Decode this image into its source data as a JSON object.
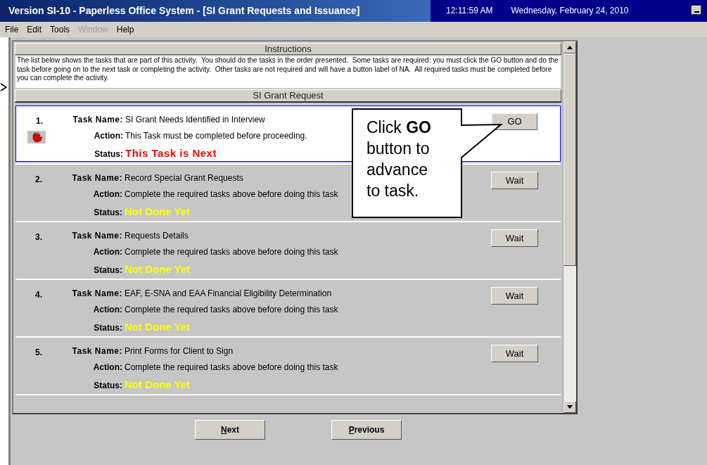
{
  "window": {
    "title": "Version SI-10 - Paperless Office System - [SI Grant Requests and Issuance]",
    "time": "12:11:59 AM",
    "date": "Wednesday, February 24, 2010"
  },
  "menu": [
    {
      "label": "File",
      "disabled": false
    },
    {
      "label": "Edit",
      "disabled": false
    },
    {
      "label": "Tools",
      "disabled": false
    },
    {
      "label": "Window",
      "disabled": true
    },
    {
      "label": "Help",
      "disabled": false
    }
  ],
  "instructions": {
    "heading": "Instructions",
    "text": "The list below shows the tasks that are part of this activity.  You should do the tasks in the order presented.  Some tasks are required: you must click the GO button and do the task before going on to the next task or completing the activity.  Other tasks are not required and will have a button label of NA.  All required tasks must be completed before you can complete the activity."
  },
  "section": {
    "heading": "SI Grant Request"
  },
  "tasks": [
    {
      "number": "1.",
      "name_label": "Task Name:",
      "name": "SI Grant Needs Identified in Interview",
      "action_label": "Action:",
      "action": "This Task must be completed before proceeding.",
      "status_label": "Status:",
      "status": "This Task is Next",
      "selected": true,
      "button": "GO"
    },
    {
      "number": "2.",
      "name_label": "Task Name:",
      "name": "Record Special Grant Requests",
      "action_label": "Action:",
      "action": "Complete the required tasks above before doing this task",
      "status_label": "Status:",
      "status": "Not Done Yet",
      "selected": false,
      "button": "Wait"
    },
    {
      "number": "3.",
      "name_label": "Task Name:",
      "name": "Requests Details",
      "action_label": "Action:",
      "action": "Complete the required tasks above before doing this task",
      "status_label": "Status:",
      "status": "Not Done Yet",
      "selected": false,
      "button": "Wait"
    },
    {
      "number": "4.",
      "name_label": "Task Name:",
      "name": "EAF, E-SNA and EAA Financial Eligibility Determination",
      "action_label": "Action:",
      "action": "Complete the required tasks above before doing this task",
      "status_label": "Status:",
      "status": "Not Done Yet",
      "selected": false,
      "button": "Wait"
    },
    {
      "number": "5.",
      "name_label": "Task Name:",
      "name": "Print Forms for Client to Sign",
      "action_label": "Action:",
      "action": "Complete the required tasks above before doing this task",
      "status_label": "Status:",
      "status": "Not Done Yet",
      "selected": false,
      "button": "Wait"
    }
  ],
  "callout": {
    "text": "Click **GO** button to advance to task."
  },
  "buttons": [
    {
      "label": "Next"
    },
    {
      "label": "Previous"
    }
  ]
}
